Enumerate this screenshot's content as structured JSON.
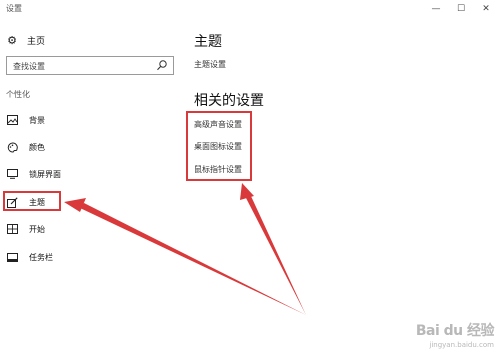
{
  "window": {
    "title": "设置",
    "minimize_glyph": "—",
    "maximize_glyph": "☐",
    "close_glyph": "✕"
  },
  "sidebar": {
    "home_label": "主页",
    "home_icon": "gear-icon",
    "search_placeholder": "查找设置",
    "section_label": "个性化",
    "items": [
      {
        "label": "背景",
        "icon": "picture-icon"
      },
      {
        "label": "颜色",
        "icon": "palette-icon"
      },
      {
        "label": "锁屏界面",
        "icon": "monitor-icon"
      },
      {
        "label": "主题",
        "icon": "brush-icon",
        "selected": true
      },
      {
        "label": "开始",
        "icon": "start-grid-icon"
      },
      {
        "label": "任务栏",
        "icon": "taskbar-icon"
      }
    ]
  },
  "main": {
    "title": "主题",
    "theme_settings_link": "主题设置",
    "related_title": "相关的设置",
    "related_links": [
      "高级声音设置",
      "桌面图标设置",
      "鼠标指针设置"
    ]
  },
  "annotation": {
    "color": "#d9393a"
  },
  "watermark": {
    "brand": "Bai du 经验",
    "url": "jingyan.baidu.com"
  }
}
